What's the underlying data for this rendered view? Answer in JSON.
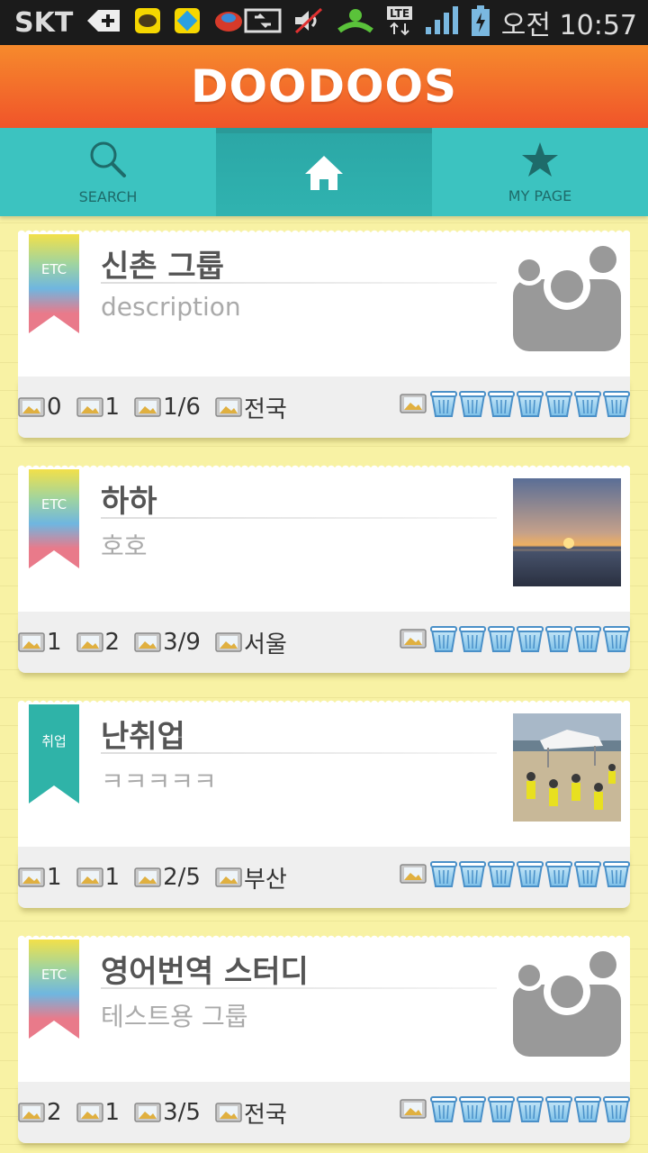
{
  "status_bar": {
    "carrier": "SKT",
    "network": "LTE",
    "time": "오전 10:57"
  },
  "header": {
    "title": "DOODOOS"
  },
  "nav": {
    "tabs": [
      {
        "label": "SEARCH",
        "icon": "search-icon"
      },
      {
        "label": "",
        "icon": "home-icon",
        "active": true
      },
      {
        "label": "MY PAGE",
        "icon": "star-icon"
      }
    ]
  },
  "colors": {
    "orange": "#f0542a",
    "teal": "#3cc3c0",
    "background": "#f8f2a4"
  },
  "groups": [
    {
      "category": "ETC",
      "ribbon": "rainbow",
      "title": "신촌 그룹",
      "description": "description",
      "thumbnail": "default-group-icon",
      "stat1": "0",
      "stat2": "1",
      "stat3": "1/6",
      "region": "전국",
      "cups": 7
    },
    {
      "category": "ETC",
      "ribbon": "rainbow",
      "title": "하하",
      "description": "호호",
      "thumbnail": "sunset-photo",
      "stat1": "1",
      "stat2": "2",
      "stat3": "3/9",
      "region": "서울",
      "cups": 7
    },
    {
      "category": "취업",
      "ribbon": "teal",
      "title": "난취업",
      "description": "ㅋㅋㅋㅋㅋ",
      "thumbnail": "beach-people-photo",
      "stat1": "1",
      "stat2": "1",
      "stat3": "2/5",
      "region": "부산",
      "cups": 7
    },
    {
      "category": "ETC",
      "ribbon": "rainbow",
      "title": "영어번역 스터디",
      "description": "테스트용 그룹",
      "thumbnail": "default-group-icon",
      "stat1": "2",
      "stat2": "1",
      "stat3": "3/5",
      "region": "전국",
      "cups": 7
    }
  ]
}
